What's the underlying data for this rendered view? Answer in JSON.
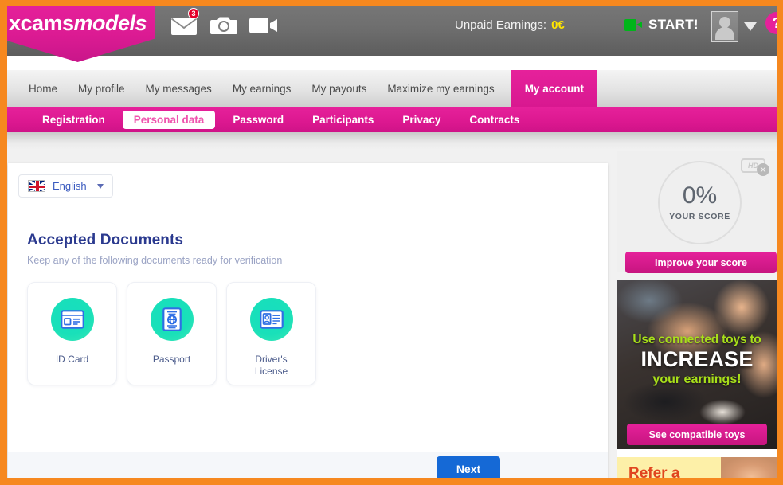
{
  "brand": {
    "logo_prefix": "xcams",
    "logo_suffix": "models"
  },
  "header": {
    "mail_icon": "envelope-icon",
    "mail_badge": "3",
    "photo_icon": "camera-icon",
    "video_icon": "video-camera-icon",
    "unpaid_label": "Unpaid Earnings:",
    "unpaid_value": "0€",
    "start_label": "START!",
    "avatar_icon": "avatar-icon",
    "caret_icon": "chevron-down-icon",
    "help_label": "?"
  },
  "nav": {
    "items": [
      {
        "label": "Home",
        "active": false
      },
      {
        "label": "My profile",
        "active": false
      },
      {
        "label": "My messages",
        "active": false
      },
      {
        "label": "My earnings",
        "active": false
      },
      {
        "label": "My payouts",
        "active": false
      },
      {
        "label": "Maximize my earnings",
        "active": false
      },
      {
        "label": "My account",
        "active": true
      }
    ]
  },
  "subnav": {
    "items": [
      {
        "label": "Registration",
        "active": false
      },
      {
        "label": "Personal data",
        "active": true
      },
      {
        "label": "Password",
        "active": false
      },
      {
        "label": "Participants",
        "active": false
      },
      {
        "label": "Privacy",
        "active": false
      },
      {
        "label": "Contracts",
        "active": false
      }
    ]
  },
  "main": {
    "language": {
      "flag": "uk-flag-icon",
      "name": "English",
      "caret": "chevron-down-icon"
    },
    "documents_title": "Accepted Documents",
    "documents_subtitle": "Keep any of the following documents ready for verification",
    "documents": [
      {
        "label": "ID Card",
        "icon": "id-card-icon"
      },
      {
        "label": "Passport",
        "icon": "passport-icon"
      },
      {
        "label": "Driver's\nLicense",
        "icon": "drivers-license-icon"
      }
    ],
    "next_label": "Next"
  },
  "sidebar": {
    "score": {
      "percent": "0%",
      "label": "YOUR SCORE",
      "hd_badge": "HD",
      "hd_close_icon": "close-icon",
      "improve_label": "Improve your score"
    },
    "promo": {
      "line1": "Use connected toys to",
      "line2": "INCREASE",
      "line3": "your earnings!",
      "button": "See compatible toys"
    },
    "promo2": {
      "text": "Refer a"
    }
  },
  "colors": {
    "frame_orange": "#f6881f",
    "brand_pink": "#e6219b",
    "accent_blue": "#1569d6",
    "doc_teal": "#19e0b9",
    "title_navy": "#2b3a8f",
    "promo_green": "#a8e01a",
    "earnings_yellow": "#ffe500",
    "start_green": "#00b51a",
    "badge_red": "#e4002b"
  }
}
